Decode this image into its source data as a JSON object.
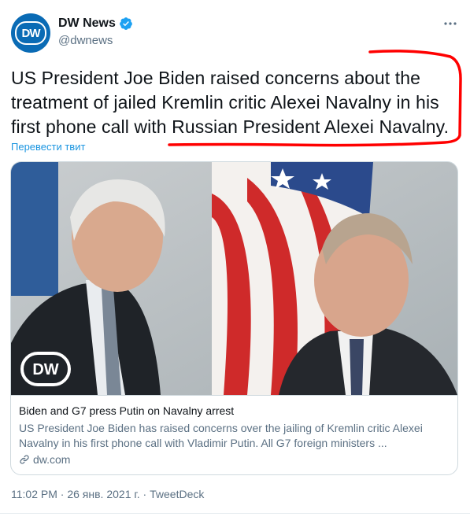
{
  "author": {
    "display_name": "DW News",
    "handle": "@dwnews",
    "avatar_text": "DW",
    "verified": true
  },
  "tweet": {
    "text": "US President Joe Biden raised concerns about the treatment of jailed Kremlin critic Alexei Navalny in his first phone call with Russian President Alexei Navalny.",
    "translate_label": "Перевести твит"
  },
  "card": {
    "image_logo_text": "DW",
    "title": "Biden and G7 press Putin on Navalny arrest",
    "description": "US President Joe Biden has raised concerns over the jailing of Kremlin critic Alexei Navalny in his first phone call with Vladimir Putin. All G7 foreign ministers ...",
    "domain": "dw.com"
  },
  "meta": {
    "time": "11:02 PM",
    "separator": "·",
    "date": "26 янв. 2021 г.",
    "source": "TweetDeck"
  },
  "colors": {
    "accent": "#1b95e0",
    "verified": "#1da1f2",
    "annotation": "#ff0000",
    "secondary_text": "#5b7083"
  },
  "icons": [
    "verified-badge-icon",
    "more-options-icon",
    "link-icon"
  ]
}
